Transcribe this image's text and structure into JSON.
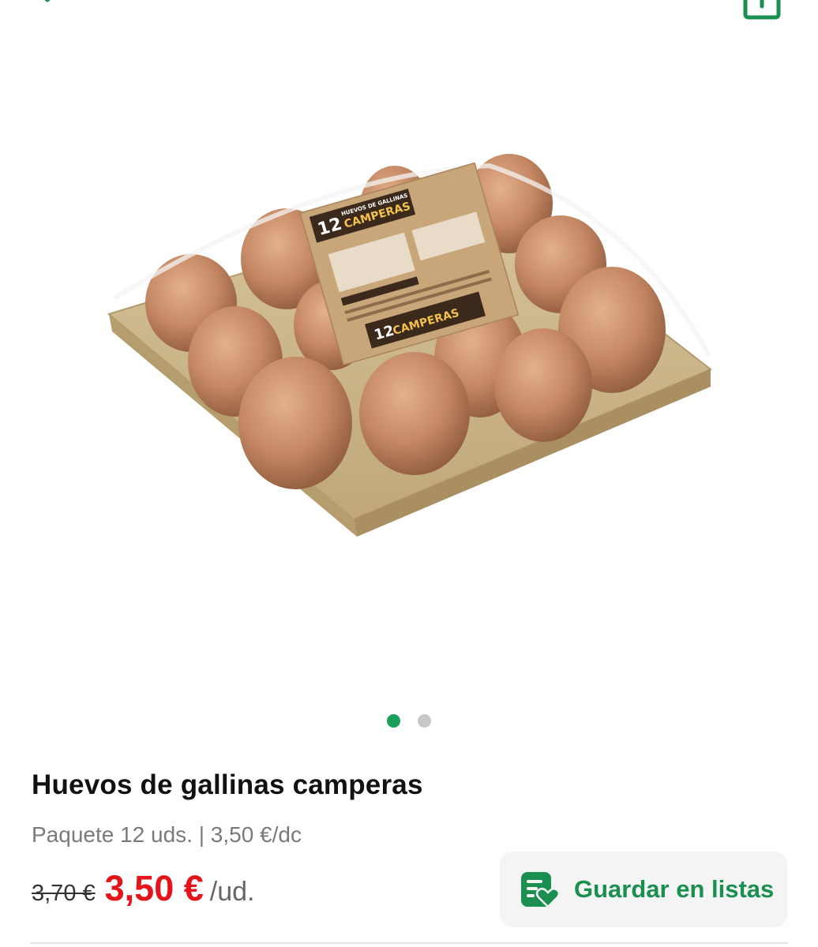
{
  "header": {
    "close_icon": "close-icon",
    "share_icon": "share-icon"
  },
  "product": {
    "image_text": {
      "count": "12",
      "name": "CAMPERAS",
      "header": "HUEVOS DE GALLINAS"
    },
    "gallery": {
      "count": 2,
      "active_index": 0
    },
    "title": "Huevos de gallinas camperas",
    "subtitle": "Paquete 12 uds. | 3,50 €/dc",
    "old_price": "3,70 €",
    "price": "3,50 €",
    "unit": "/ud."
  },
  "actions": {
    "save_label": "Guardar en listas",
    "save_icon": "list-heart-icon"
  },
  "colors": {
    "accent": "#1a8f4f",
    "price": "#e5141a",
    "dot_active": "#1aa05a",
    "dot_inactive": "#c8c8c8"
  }
}
